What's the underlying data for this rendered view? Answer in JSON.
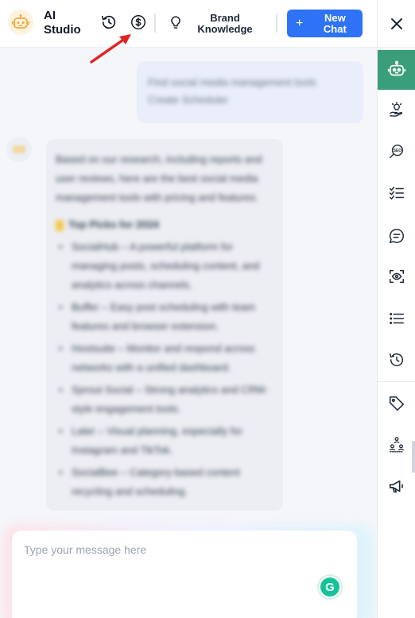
{
  "header": {
    "title": "AI Studio",
    "brand_knowledge_label": "Brand Knowledge",
    "new_chat_label": "New Chat",
    "new_chat_icon": "+"
  },
  "conversation": {
    "user_message": {
      "line1": "Find social media management tools",
      "line2": "Create Scheduler"
    },
    "bot_message": {
      "intro": "Based on our research, including reports and user reviews, here are the best social media management tools with pricing and features.",
      "heading": "Top Picks for 2024",
      "bullets": [
        "SocialHub – A powerful platform for managing posts, scheduling content, and analytics across channels.",
        "Buffer – Easy post scheduling with team features and browser extension.",
        "Hootsuite – Monitor and respond across networks with a unified dashboard.",
        "Sprout Social – Strong analytics and CRM-style engagement tools.",
        "Later – Visual planning, especially for Instagram and TikTok.",
        "SocialBee – Category-based content recycling and scheduling."
      ]
    }
  },
  "composer": {
    "placeholder": "Type your message here",
    "grammarly_letter": "G"
  },
  "colors": {
    "primary": "#2e72f5",
    "active_rail": "#3a9e7a",
    "annotation_arrow": "#e02424"
  }
}
